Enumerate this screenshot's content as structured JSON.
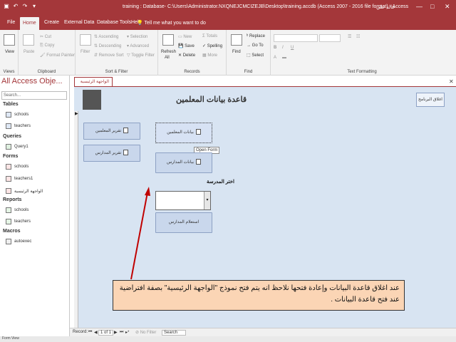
{
  "titlebar": {
    "title": "training : Database- C:\\Users\\Administrator.NXQNEJCMCIZEJB\\Desktop\\training.accdb (Access 2007 - 2016 file format) - Access",
    "user": "خالد علي",
    "minimize": "—",
    "maximize": "□",
    "close": "✕",
    "qat": [
      "▣",
      "↶",
      "↷",
      "▾"
    ]
  },
  "tabs": [
    {
      "label": "File"
    },
    {
      "label": "Home"
    },
    {
      "label": "Create"
    },
    {
      "label": "External Data"
    },
    {
      "label": "Database Tools"
    },
    {
      "label": "Help"
    }
  ],
  "tellme": "Tell me what you want to do",
  "ribbon": {
    "views": {
      "view": "View",
      "group": "Views"
    },
    "clipboard": {
      "paste": "Paste",
      "cut": "Cut",
      "copy": "Copy",
      "format_painter": "Format Painter",
      "group": "Clipboard"
    },
    "sortfilter": {
      "filter": "Filter",
      "ascending": "Ascending",
      "descending": "Descending",
      "remove_sort": "Remove Sort",
      "selection": "Selection",
      "advanced": "Advanced",
      "toggle_filter": "Toggle Filter",
      "group": "Sort & Filter"
    },
    "records": {
      "refresh": "Refresh",
      "refresh_all": "All",
      "new": "New",
      "save": "Save",
      "delete": "Delete",
      "totals": "Totals",
      "spelling": "Spelling",
      "more": "More",
      "group": "Records"
    },
    "find": {
      "find": "Find",
      "replace": "Replace",
      "goto": "Go To",
      "select": "Select",
      "group": "Find"
    },
    "textformat": {
      "group": "Text Formatting"
    }
  },
  "nav": {
    "header": "All Access Obje...",
    "search_placeholder": "Search...",
    "categories": {
      "tables": "Tables",
      "queries": "Queries",
      "forms": "Forms",
      "reports": "Reports",
      "macros": "Macros"
    },
    "tables": [
      "schools",
      "teachers"
    ],
    "queries": [
      "Query1"
    ],
    "forms": [
      "schools",
      "teachers1",
      "الواجهة الرئيسية"
    ],
    "reports": [
      "schools",
      "teachers"
    ],
    "macros": [
      "autoexec"
    ]
  },
  "document": {
    "tab_label": "الواجهة الرئيسية",
    "close_icon": "✕"
  },
  "form": {
    "title": "قاعدة بيانات المعلمين",
    "close_program": "اغلاق البرنامج",
    "btn_teachers_report": "تقرير المعلمين",
    "btn_schools_report": "تقرير المدارس",
    "btn_teachers_data": "بيانات المعلمين",
    "btn_schools_data": "بيانات المدارس",
    "tooltip": "Open Form",
    "school_label": "اختر المدرسة",
    "query_schools": "استعلام المدارس"
  },
  "callout": "عند اغلاق قاعدة البيانات وإعادة فتحها نلاحظ انه يتم فتح نموذج \"الواجهة الرئيسية\" بصفة افتراضية عند فتح قاعدة البيانات .",
  "recordbar": {
    "record_label": "Record:",
    "position": "1 of 1",
    "no_filter": "No Filter",
    "search": "Search"
  },
  "statusbar": {
    "text": "Form View"
  },
  "colors": {
    "accent": "#a4373a",
    "form_background": "#d8e4f2",
    "callout_background": "#fbd5b5"
  }
}
